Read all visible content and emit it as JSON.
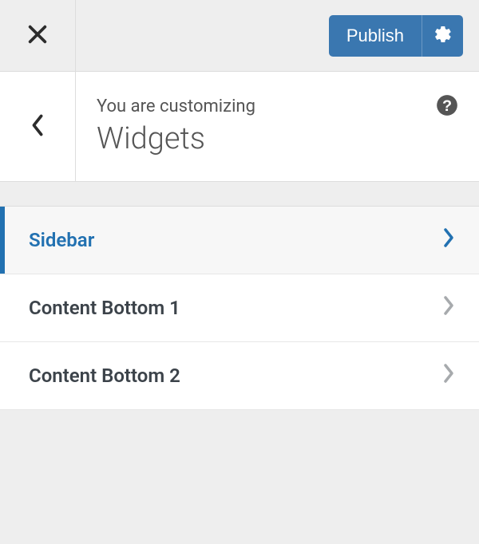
{
  "topbar": {
    "publish_label": "Publish"
  },
  "header": {
    "subtitle": "You are customizing",
    "title": "Widgets"
  },
  "widgets": [
    {
      "label": "Sidebar",
      "active": true
    },
    {
      "label": "Content Bottom 1",
      "active": false
    },
    {
      "label": "Content Bottom 2",
      "active": false
    }
  ]
}
